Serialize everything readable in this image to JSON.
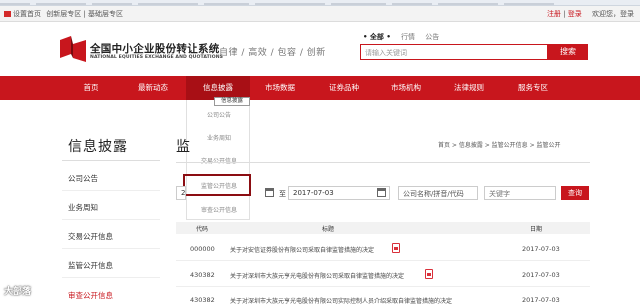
{
  "topbar": {
    "home_link": "设置首页",
    "left_links": "创新层专区 | 基础层专区",
    "register": "注册",
    "login": "登录",
    "welcome": "欢迎您，登录"
  },
  "header": {
    "site_name_cn": "全国中小企业股份转让系统",
    "site_name_en": "NATIONAL EQUITIES EXCHANGE AND QUOTATIONS",
    "slogan": "自律 / 高效 / 包容 / 创新",
    "scope_all": "• 全部 •",
    "scope_quotes": "行情",
    "scope_notice": "公告",
    "search_placeholder": "请输入关键词",
    "search_button": "搜索"
  },
  "nav": {
    "items": [
      "首页",
      "最新动态",
      "信息披露",
      "市场数据",
      "证券品种",
      "市场机构",
      "法律规则",
      "服务专区"
    ],
    "active_index": 2
  },
  "dropdown": {
    "caption": "信息披露",
    "items": [
      "公司公告",
      "业务周知",
      "交易公开信息",
      "监管公开信息",
      "审查公开信息"
    ],
    "highlighted_index": 3
  },
  "sidebar": {
    "title": "信息披露",
    "items": [
      "公司公告",
      "业务周知",
      "交易公开信息",
      "监管公开信息",
      "审查公开信息"
    ],
    "active_index": 4
  },
  "content": {
    "title": "监",
    "breadcrumb": "首页 > 信息披露 > 监管公开信息 > 监管公开",
    "filter": {
      "start_date": "2",
      "to_label": "至",
      "end_date": "2017-07-03",
      "company_placeholder": "公司名称/拼音/代码",
      "keyword_placeholder": "关键字",
      "query_button": "查询"
    },
    "table": {
      "headers": [
        "代码",
        "标题",
        "日期"
      ],
      "rows": [
        {
          "code": "000000",
          "title": "关于对安信证券股份有限公司采取自律监管措施的决定",
          "date": "2017-07-03"
        },
        {
          "code": "430382",
          "title": "关于对深圳市大族元亨光电股份有限公司采取自律监管措施的决定",
          "date": "2017-07-03"
        },
        {
          "code": "430382",
          "title": "关于对深圳市大族元亨光电股份有限公司实际控制人员介绍采取自律监管措施的决定",
          "date": "2017-07-03"
        }
      ]
    }
  },
  "watermark": "大部落"
}
